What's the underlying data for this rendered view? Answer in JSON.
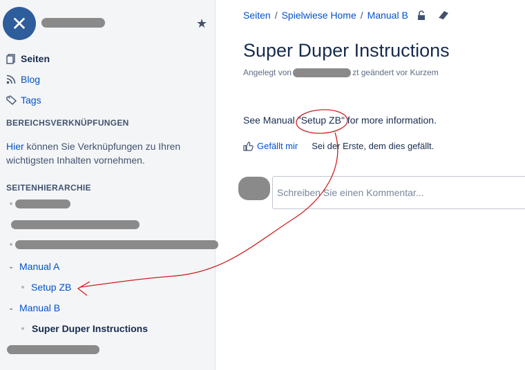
{
  "sidebar": {
    "space_logo_glyph": "✕",
    "star_glyph": "★",
    "nav": {
      "pages": "Seiten",
      "blog": "Blog",
      "tags": "Tags"
    },
    "shortcuts": {
      "title": "BEREICHSVERKNÜPFUNGEN",
      "link": "Hier",
      "text": " können Sie Verknüpfungen zu Ihren wichtigsten Inhalten vornehmen."
    },
    "hierarchy": {
      "title": "SEITENHIERARCHIE",
      "items": [
        {
          "label": "Manual A",
          "expanded": true
        },
        {
          "label": "Setup ZB"
        },
        {
          "label": "Manual B",
          "expanded": true
        },
        {
          "label": "Super Duper Instructions",
          "current": true
        }
      ]
    }
  },
  "breadcrumb": {
    "items": [
      "Seiten",
      "Spielwiese Home",
      "Manual B"
    ],
    "separator": "/"
  },
  "page": {
    "title": "Super Duper Instructions",
    "byline_prefix": "Angelegt von",
    "byline_suffix": "zt geändert vor Kurzem",
    "body_before": "See Manual ",
    "body_link": "\"Setup ZB\"",
    "body_after": " for more information.",
    "like_label": "Gefällt mir",
    "like_note": "Sei der Erste, dem dies gefällt.",
    "comment_placeholder": "Schreiben Sie einen Kommentar..."
  },
  "colors": {
    "link": "#0052cc",
    "annotation": "#cc1f1f",
    "logo": "#2e5d9b"
  }
}
